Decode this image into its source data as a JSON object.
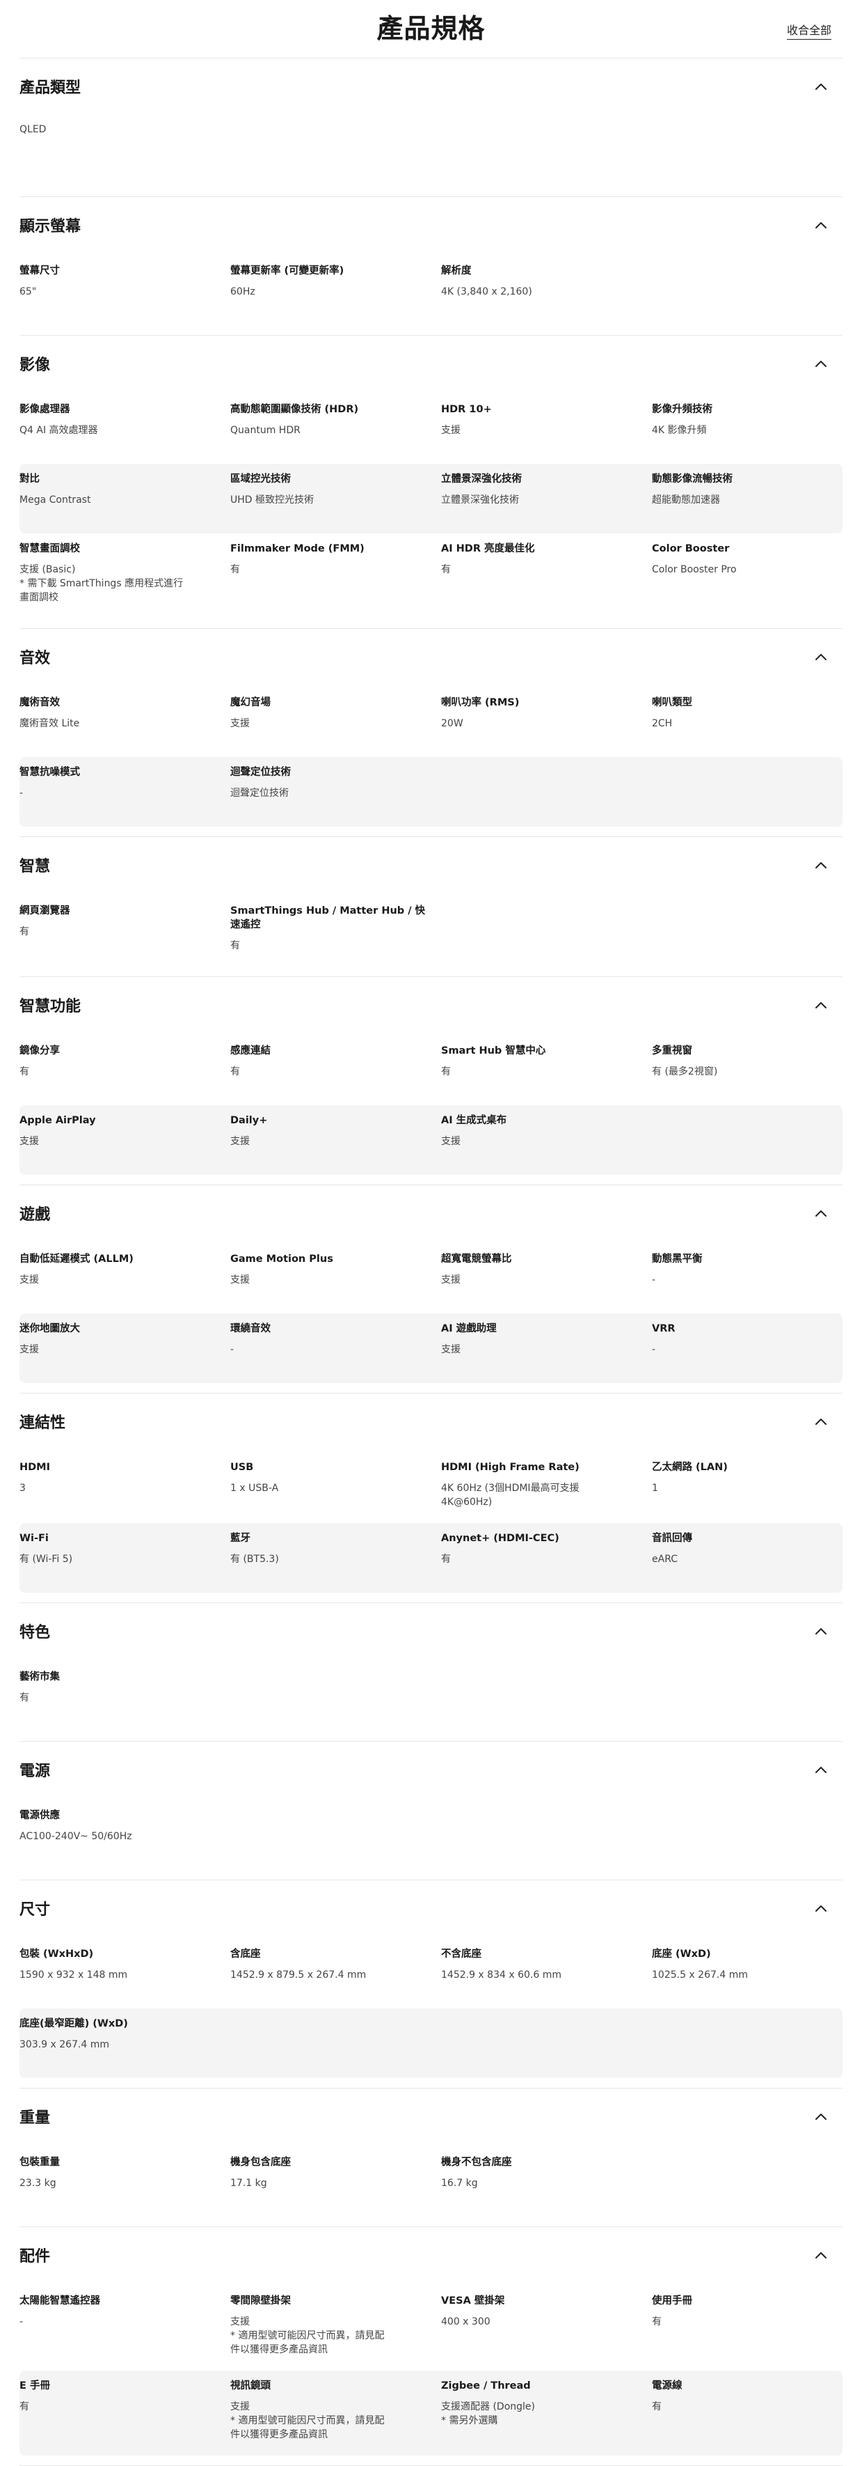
{
  "page": {
    "title": "產品規格",
    "collapse_all": "收合全部"
  },
  "sections": [
    {
      "title": "產品類型",
      "rows": [
        [
          {
            "label": "",
            "value": "QLED"
          }
        ]
      ]
    },
    {
      "title": "顯示螢幕",
      "rows": [
        [
          {
            "label": "螢幕尺寸",
            "value": "65\""
          },
          {
            "label": "螢幕更新率 (可變更新率)",
            "value": "60Hz"
          },
          {
            "label": "解析度",
            "value": "4K (3,840 x 2,160)"
          }
        ]
      ]
    },
    {
      "title": "影像",
      "rows": [
        [
          {
            "label": "影像處理器",
            "value": "Q4 AI 高效處理器"
          },
          {
            "label": "高動態範圍顯像技術 (HDR)",
            "value": "Quantum HDR"
          },
          {
            "label": "HDR 10+",
            "value": "支援"
          },
          {
            "label": "影像升頻技術",
            "value": "4K 影像升頻"
          }
        ],
        [
          {
            "label": "對比",
            "value": "Mega Contrast"
          },
          {
            "label": "區域控光技術",
            "value": "UHD 極致控光技術"
          },
          {
            "label": "立體景深強化技術",
            "value": "立體景深強化技術"
          },
          {
            "label": "動態影像流暢技術",
            "value": "超能動態加速器"
          }
        ],
        [
          {
            "label": "智慧畫面調校",
            "value": "支援 (Basic)\n* 需下載 SmartThings 應用程式進行\n畫面調校"
          },
          {
            "label": "Filmmaker Mode (FMM)",
            "value": "有"
          },
          {
            "label": "AI HDR 亮度最佳化",
            "value": "有"
          },
          {
            "label": "Color Booster",
            "value": "Color Booster Pro"
          }
        ]
      ]
    },
    {
      "title": "音效",
      "rows": [
        [
          {
            "label": "魔術音效",
            "value": "魔術音效 Lite"
          },
          {
            "label": "魔幻音場",
            "value": "支援"
          },
          {
            "label": "喇叭功率 (RMS)",
            "value": "20W"
          },
          {
            "label": "喇叭類型",
            "value": "2CH"
          }
        ],
        [
          {
            "label": "智慧抗噪模式",
            "value": "-"
          },
          {
            "label": "迴聲定位技術",
            "value": "迴聲定位技術"
          }
        ]
      ]
    },
    {
      "title": "智慧",
      "rows": [
        [
          {
            "label": "網頁瀏覽器",
            "value": "有"
          },
          {
            "label": "SmartThings Hub / Matter Hub / 快\n速遙控",
            "value": "有"
          }
        ]
      ]
    },
    {
      "title": "智慧功能",
      "rows": [
        [
          {
            "label": "鏡像分享",
            "value": "有"
          },
          {
            "label": "感應連結",
            "value": "有"
          },
          {
            "label": "Smart Hub 智慧中心",
            "value": "有"
          },
          {
            "label": "多重視窗",
            "value": "有 (最多2視窗)"
          }
        ],
        [
          {
            "label": "Apple AirPlay",
            "value": "支援"
          },
          {
            "label": "Daily+",
            "value": "支援"
          },
          {
            "label": "AI 生成式桌布",
            "value": "支援"
          }
        ]
      ]
    },
    {
      "title": "遊戲",
      "rows": [
        [
          {
            "label": "自動低延遲模式 (ALLM)",
            "value": "支援"
          },
          {
            "label": "Game Motion Plus",
            "value": "支援"
          },
          {
            "label": "超寬電競螢幕比",
            "value": "支援"
          },
          {
            "label": "動態黑平衡",
            "value": "-"
          }
        ],
        [
          {
            "label": "迷你地圖放大",
            "value": "支援"
          },
          {
            "label": "環繞音效",
            "value": "-"
          },
          {
            "label": "AI 遊戲助理",
            "value": "支援"
          },
          {
            "label": "VRR",
            "value": "-"
          }
        ]
      ]
    },
    {
      "title": "連結性",
      "rows": [
        [
          {
            "label": "HDMI",
            "value": "3"
          },
          {
            "label": "USB",
            "value": "1 x USB-A"
          },
          {
            "label": "HDMI (High Frame Rate)",
            "value": "4K 60Hz (3個HDMI最高可支援\n4K@60Hz)"
          },
          {
            "label": "乙太網路 (LAN)",
            "value": "1"
          }
        ],
        [
          {
            "label": "Wi-Fi",
            "value": "有 (Wi-Fi 5)"
          },
          {
            "label": "藍牙",
            "value": "有 (BT5.3)"
          },
          {
            "label": "Anynet+ (HDMI-CEC)",
            "value": "有"
          },
          {
            "label": "音訊回傳",
            "value": "eARC"
          }
        ]
      ]
    },
    {
      "title": "特色",
      "rows": [
        [
          {
            "label": "藝術市集",
            "value": "有"
          }
        ]
      ]
    },
    {
      "title": "電源",
      "rows": [
        [
          {
            "label": "電源供應",
            "value": "AC100-240V~ 50/60Hz"
          }
        ]
      ]
    },
    {
      "title": "尺寸",
      "rows": [
        [
          {
            "label": "包裝 (WxHxD)",
            "value": "1590 x 932 x 148 mm"
          },
          {
            "label": "含底座",
            "value": "1452.9 x 879.5 x 267.4 mm"
          },
          {
            "label": "不含底座",
            "value": "1452.9 x 834 x 60.6 mm"
          },
          {
            "label": "底座 (WxD)",
            "value": "1025.5 x 267.4 mm"
          }
        ],
        [
          {
            "label": "底座(最窄距離) (WxD)",
            "value": "303.9 x 267.4 mm"
          }
        ]
      ]
    },
    {
      "title": "重量",
      "rows": [
        [
          {
            "label": "包裝重量",
            "value": "23.3 kg"
          },
          {
            "label": "機身包含底座",
            "value": "17.1 kg"
          },
          {
            "label": "機身不包含底座",
            "value": "16.7 kg"
          }
        ]
      ]
    },
    {
      "title": "配件",
      "rows": [
        [
          {
            "label": "太陽能智慧遙控器",
            "value": "-"
          },
          {
            "label": "零間隙壁掛架",
            "value": "支援\n* 適用型號可能因尺寸而異，請見配\n件以獲得更多產品資訊"
          },
          {
            "label": "VESA 壁掛架",
            "value": "400 x 300"
          },
          {
            "label": "使用手冊",
            "value": "有"
          }
        ],
        [
          {
            "label": "E 手冊",
            "value": "有"
          },
          {
            "label": "視訊鏡頭",
            "value": "支援\n* 適用型號可能因尺寸而異，請見配\n件以獲得更多產品資訊"
          },
          {
            "label": "Zigbee / Thread",
            "value": "支援適配器 (Dongle)\n* 需另外選購"
          },
          {
            "label": "電源線",
            "value": "有"
          }
        ]
      ]
    }
  ]
}
